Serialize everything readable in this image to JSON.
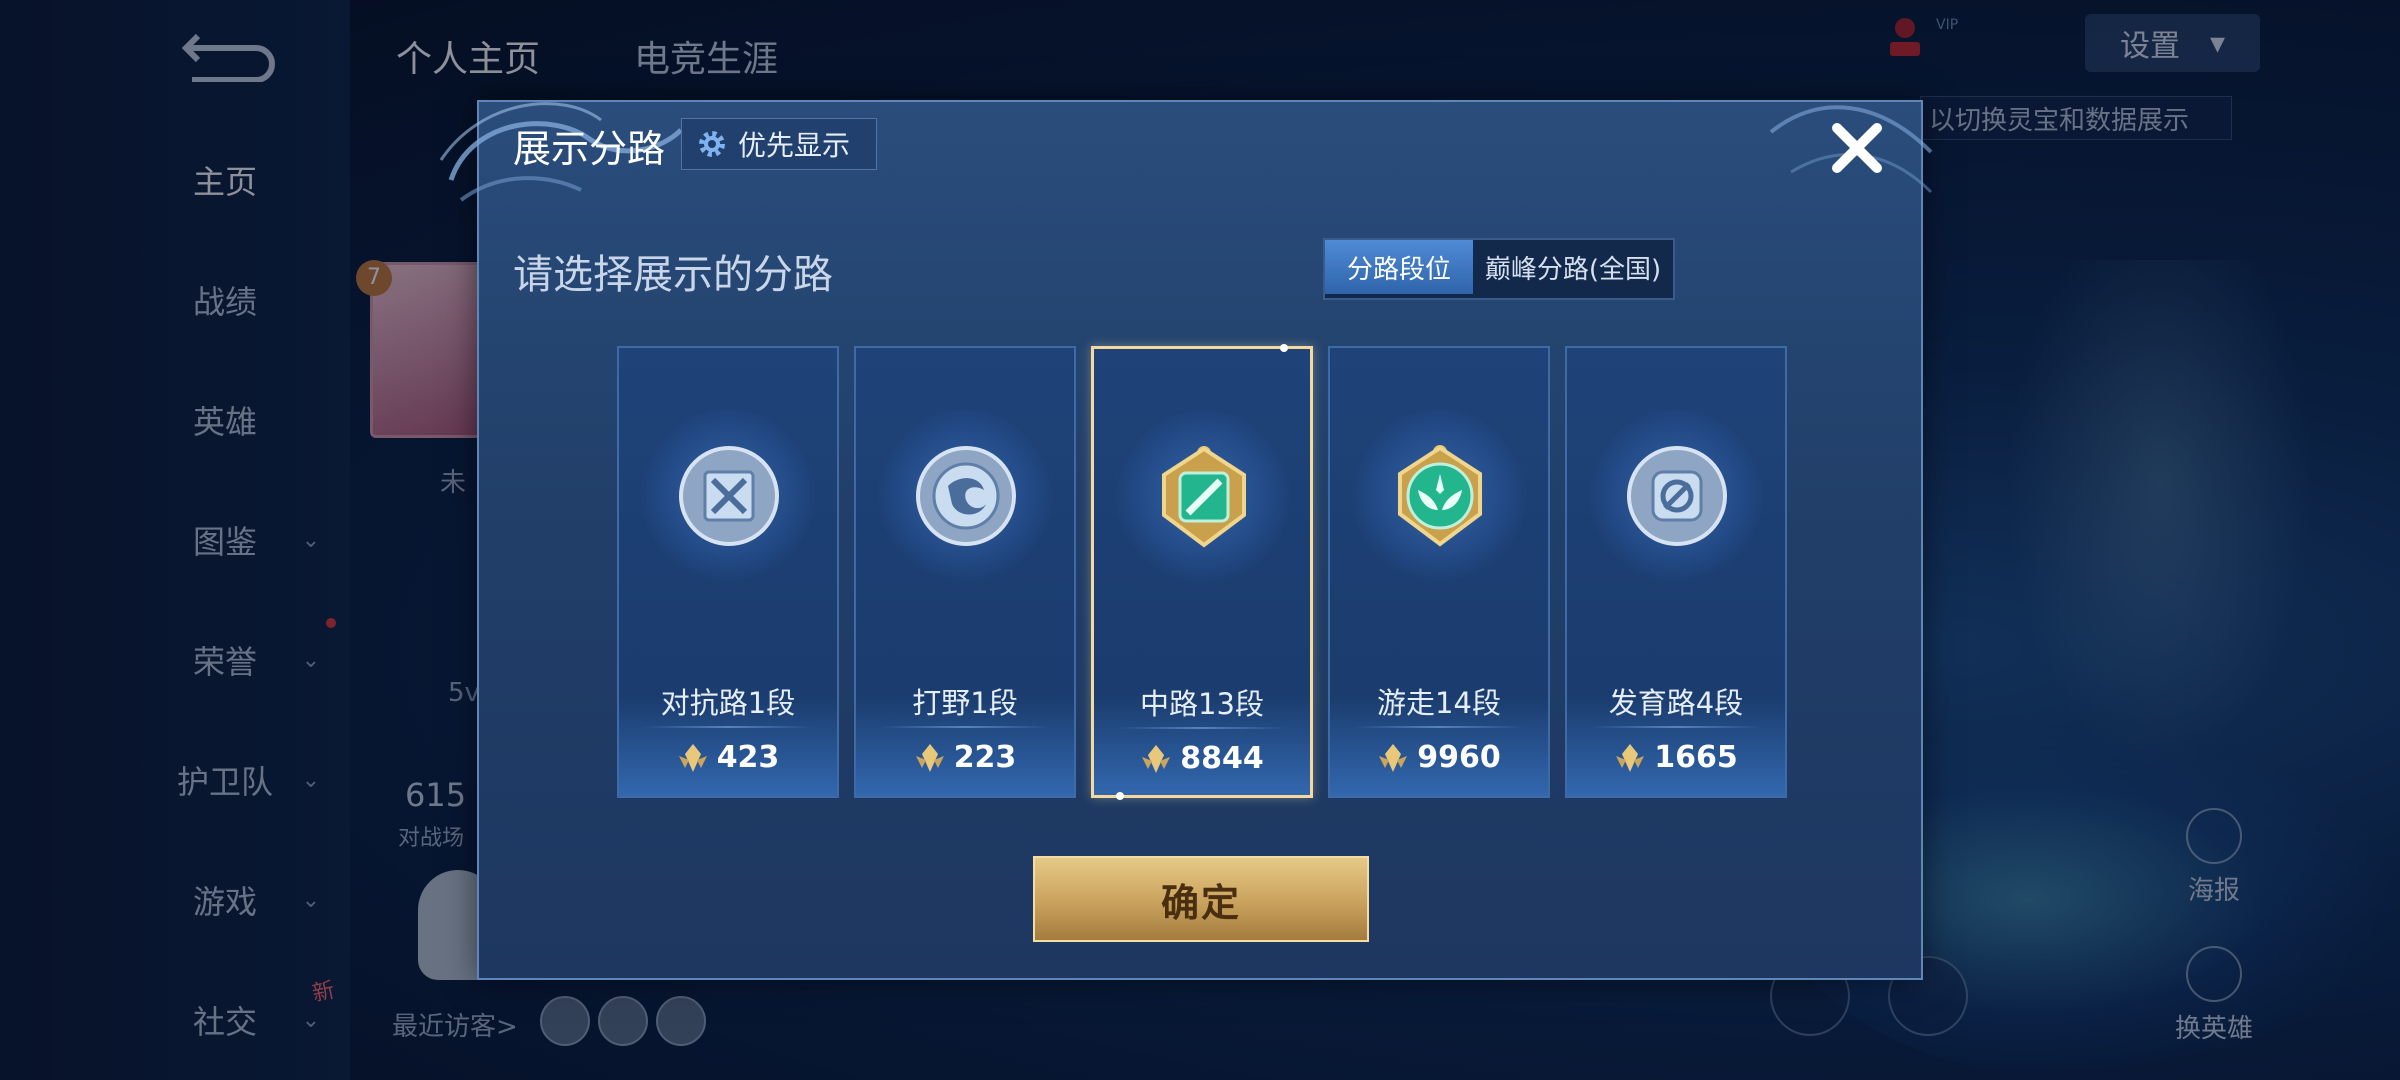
{
  "background": {
    "nav": {
      "items": [
        {
          "label": "主页"
        },
        {
          "label": "战绩"
        },
        {
          "label": "英雄"
        },
        {
          "label": "图鉴"
        },
        {
          "label": "荣誉"
        },
        {
          "label": "护卫队"
        },
        {
          "label": "游戏"
        },
        {
          "label": "社交"
        }
      ],
      "new_badge": "新"
    },
    "tabs": [
      "个人主页",
      "电竞生涯"
    ],
    "settings_label": "设置",
    "hint": "以切换灵宝和数据展示",
    "vip_label": "VIP",
    "profile": {
      "level": "7",
      "partial_text": "未",
      "partial_text2": "5v",
      "battle_count": "615",
      "battle_label": "对战场"
    },
    "recent_visitors_label": "最近访客>",
    "poster_label": "海报",
    "change_hero_label": "换英雄"
  },
  "modal": {
    "title": "展示分路",
    "priority_label": "优先显示",
    "subtitle": "请选择展示的分路",
    "toggle": {
      "active": "分路段位",
      "inactive": "巅峰分路(全国)"
    },
    "lanes": [
      {
        "name": "对抗路1段",
        "score": "423",
        "icon": "clash-lane-badge-icon",
        "tier": "silver"
      },
      {
        "name": "打野1段",
        "score": "223",
        "icon": "jungle-badge-icon",
        "tier": "silver"
      },
      {
        "name": "中路13段",
        "score": "8844",
        "icon": "mid-lane-badge-icon",
        "tier": "gold",
        "selected": true
      },
      {
        "name": "游走14段",
        "score": "9960",
        "icon": "roam-badge-icon",
        "tier": "gold"
      },
      {
        "name": "发育路4段",
        "score": "1665",
        "icon": "farm-lane-badge-icon",
        "tier": "silver"
      }
    ],
    "confirm_label": "确定"
  },
  "colors": {
    "accent_gold": "#e6c986",
    "selected_border": "#f3d9a0",
    "panel": "#2a4d7c"
  }
}
